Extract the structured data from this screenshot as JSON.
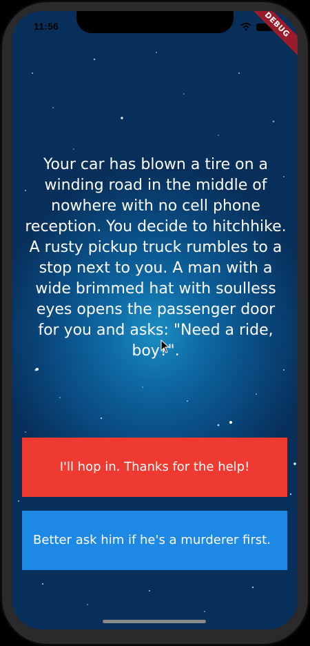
{
  "status_bar": {
    "time": "11:56",
    "icons": [
      "wifi-icon",
      "battery-icon"
    ]
  },
  "debug_banner": {
    "label": "DEBUG",
    "color": "#9a1b2a"
  },
  "story": {
    "text": "Your car has blown a tire on a winding road in the middle of nowhere with no cell phone reception. You decide to hitchhike. A rusty pickup truck rumbles to a stop next to you. A man with a wide brimmed hat with soulless eyes opens the passenger door for you and asks: \"Need a ride, boy?\"."
  },
  "choices": [
    {
      "label": "I'll hop in. Thanks for the help!",
      "color": "#ef3a31"
    },
    {
      "label": "Better ask him if he's a murderer first.",
      "color": "#1e88e5"
    }
  ]
}
